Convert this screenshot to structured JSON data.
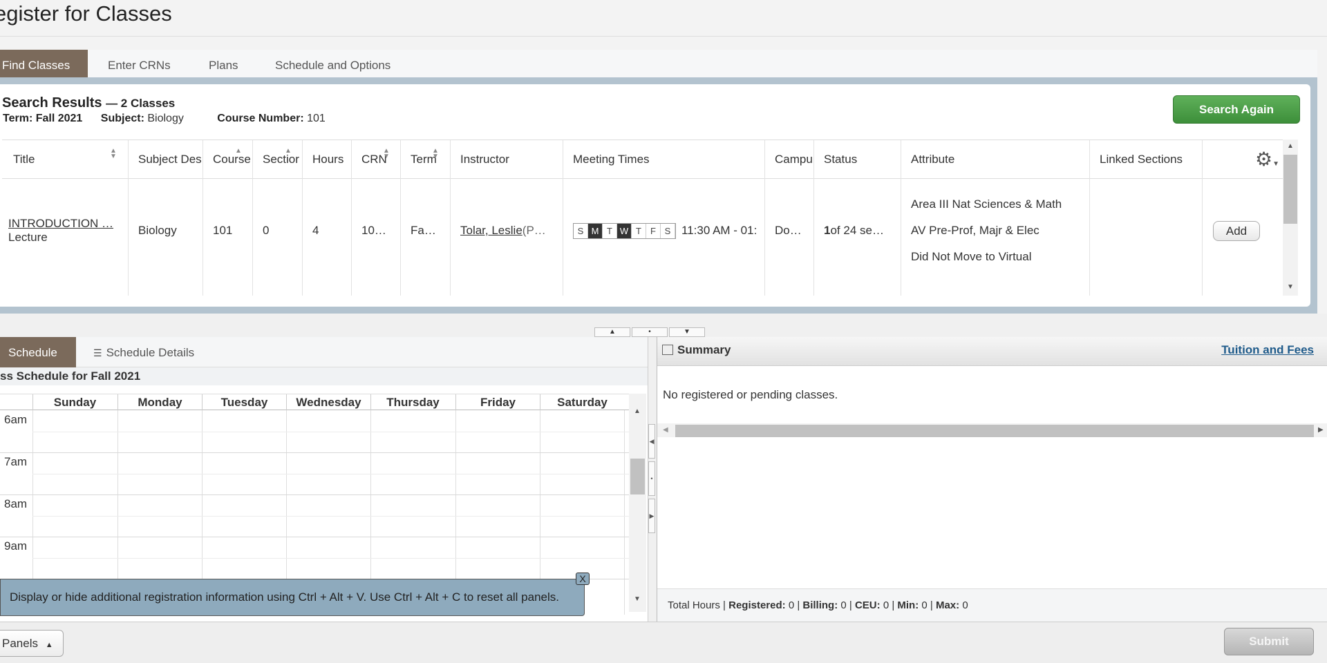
{
  "page": {
    "title": "egister for Classes"
  },
  "tabs": [
    {
      "label": "Find Classes",
      "active": true
    },
    {
      "label": "Enter CRNs"
    },
    {
      "label": "Plans"
    },
    {
      "label": "Schedule and Options"
    }
  ],
  "search_results": {
    "title": "Search Results",
    "count": "— 2 Classes",
    "term_label": "Term:",
    "term_value": "Fall 2021",
    "subject_label": "Subject:",
    "subject_value": "Biology",
    "course_label": "Course Number:",
    "course_value": "101",
    "search_again": "Search Again"
  },
  "grid": {
    "columns": [
      "Title",
      "Subject Des",
      "Course",
      "Sectior",
      "Hours",
      "CRN",
      "Term",
      "Instructor",
      "Meeting Times",
      "Campu",
      "Status",
      "Attribute",
      "Linked Sections"
    ],
    "row": {
      "title": "INTRODUCTION …",
      "schedule_type": "Lecture",
      "subject": "Biology",
      "course": "101",
      "section": "0",
      "hours": "4",
      "crn": "10…",
      "term": "Fa…",
      "instructor": "Tolar, Leslie",
      "instructor_suffix": " (P…",
      "days": [
        "S",
        "M",
        "T",
        "W",
        "T",
        "F",
        "S"
      ],
      "days_active": [
        false,
        true,
        false,
        true,
        false,
        false,
        false
      ],
      "time": "11:30 AM - 01:",
      "campus": "Do…",
      "status_bold": "1",
      "status_rest": " of 24 se…",
      "attributes": [
        "Area III Nat Sciences & Math",
        "AV Pre-Prof, Majr & Elec",
        "Did Not Move to Virtual"
      ],
      "add": "Add"
    }
  },
  "schedule": {
    "tabs": [
      "Schedule",
      "Schedule Details"
    ],
    "caption": "ss Schedule for Fall 2021",
    "days": [
      "Sunday",
      "Monday",
      "Tuesday",
      "Wednesday",
      "Thursday",
      "Friday",
      "Saturday"
    ],
    "hours": [
      "6am",
      "7am",
      "8am",
      "9am"
    ]
  },
  "tip": {
    "text": "Display or hide additional registration information using Ctrl + Alt + V. Use Ctrl + Alt + C to reset all panels.",
    "close": "X"
  },
  "summary": {
    "title": "Summary",
    "link": "Tuition and Fees",
    "empty": "No registered or pending classes.",
    "footer": {
      "total": "Total Hours |",
      "registered_label": "Registered:",
      "registered": "0",
      "billing_label": "Billing:",
      "billing": "0",
      "ceu_label": "CEU:",
      "ceu": "0",
      "min_label": "Min:",
      "min": "0",
      "max_label": "Max:",
      "max": "0"
    }
  },
  "footer": {
    "panels": "Panels",
    "submit": "Submit"
  }
}
